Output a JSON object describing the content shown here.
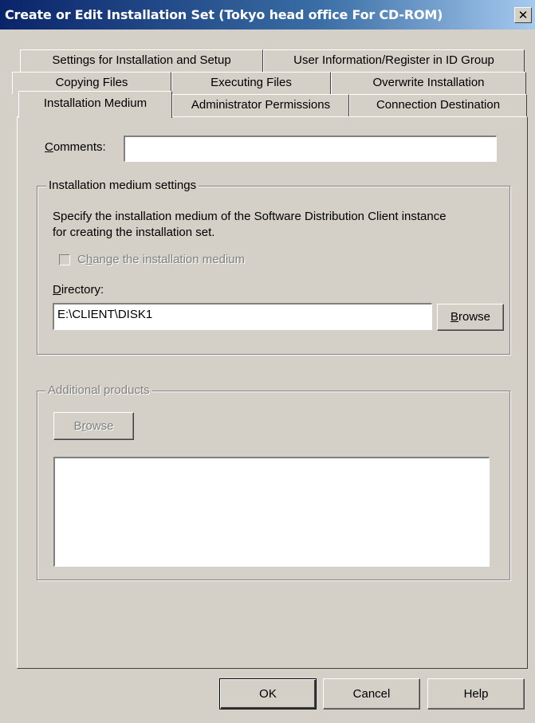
{
  "window": {
    "title": "Create or Edit Installation Set (Tokyo head office For CD-ROM)",
    "close_glyph": "✕"
  },
  "tabs": {
    "row1": [
      "Settings for Installation and Setup",
      "User Information/Register in ID Group"
    ],
    "row2": [
      "Copying Files",
      "Executing Files",
      "Overwrite Installation"
    ],
    "row3": [
      "Installation Medium",
      "Administrator Permissions",
      "Connection Destination"
    ],
    "selected": "Installation Medium"
  },
  "comments": {
    "label_first": "C",
    "label_rest": "omments:",
    "value": ""
  },
  "medium_group": {
    "title": "Installation medium settings",
    "description_line1": "Specify the installation medium of the Software Distribution Client instance",
    "description_line2": "for creating the installation set.",
    "change_checkbox_first": "C",
    "change_checkbox_u": "h",
    "change_checkbox_rest": "ange the installation medium",
    "change_checked": false,
    "directory_label_first": "D",
    "directory_label_rest": "irectory:",
    "directory_value": "E:\\CLIENT\\DISK1",
    "browse_u": "B",
    "browse_rest": "rowse"
  },
  "additional_group": {
    "title": "Additional products",
    "browse_first": "B",
    "browse_u": "r",
    "browse_rest": "owse",
    "items": []
  },
  "footer": {
    "ok": "OK",
    "cancel": "Cancel",
    "help": "Help"
  },
  "colors": {
    "dialog_bg": "#d4d0c8",
    "title_bar_start": "#0a246a",
    "title_bar_end": "#a6caf0",
    "disabled_text": "#808080"
  }
}
